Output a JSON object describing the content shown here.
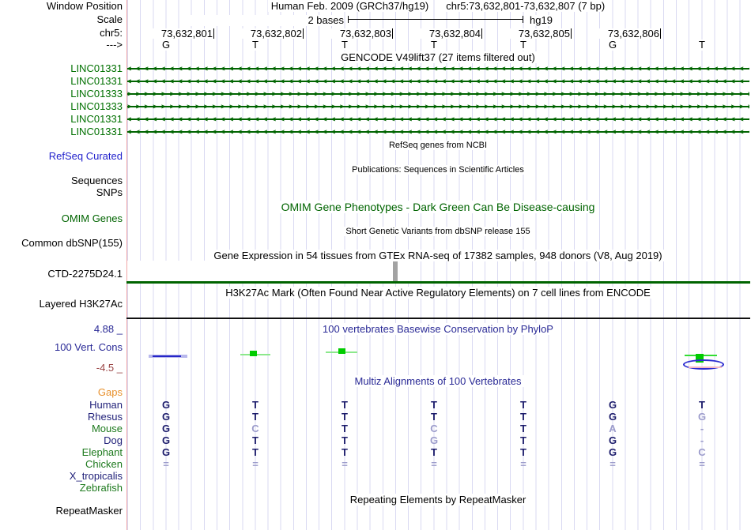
{
  "header": {
    "window_position_label": "Window Position",
    "assembly_title": "Human Feb. 2009 (GRCh37/hg19)",
    "range_title": "chr5:73,632,801-73,632,807 (7 bp)",
    "scale_label": "Scale",
    "scale_value": "2 bases",
    "scale_assembly": "hg19",
    "chrom_label": "chr5:",
    "strand_label": "--->",
    "coordinates": [
      "73,632,801",
      "73,632,802",
      "73,632,803",
      "73,632,804",
      "73,632,805",
      "73,632,806"
    ],
    "bases": [
      "G",
      "T",
      "T",
      "T",
      "T",
      "G",
      "T"
    ]
  },
  "gencode": {
    "title": "GENCODE V49lift37 (27 items filtered out)",
    "genes": [
      {
        "name": "LINC01331",
        "strand": "left"
      },
      {
        "name": "LINC01331",
        "strand": "left"
      },
      {
        "name": "LINC01333",
        "strand": "right"
      },
      {
        "name": "LINC01333",
        "strand": "right"
      },
      {
        "name": "LINC01331",
        "strand": "left"
      },
      {
        "name": "LINC01331",
        "strand": "left"
      }
    ]
  },
  "tracks": {
    "refseq": {
      "center_title": "RefSeq genes from NCBI",
      "label": "RefSeq Curated"
    },
    "publications": {
      "center_title": "Publications: Sequences in Scientific Articles",
      "label_sequences": "Sequences",
      "label_snps": "SNPs"
    },
    "omim": {
      "center_title": "OMIM Gene Phenotypes - Dark Green Can Be Disease-causing",
      "label": "OMIM Genes"
    },
    "dbsnp": {
      "center_title": "Short Genetic Variants from dbSNP release 155",
      "label": "Common dbSNP(155)"
    },
    "gtex": {
      "center_title": "Gene Expression in 54 tissues from GTEx RNA-seq of 17382 samples, 948 donors (V8, Aug 2019)",
      "label": "CTD-2275D24.1"
    },
    "h3k27ac": {
      "center_title": "H3K27Ac Mark (Often Found Near Active Regulatory Elements) on 7 cell lines from ENCODE",
      "label": "Layered H3K27Ac"
    },
    "conservation": {
      "center_title": "100 vertebrates Basewise Conservation by PhyloP",
      "label": "100 Vert. Cons",
      "max_value": "4.88 _",
      "min_value": "-4.5 _"
    },
    "multiz": {
      "center_title": "Multiz Alignments of 100 Vertebrates",
      "gaps_label": "Gaps",
      "rows": [
        {
          "species": "Human",
          "color": "navy",
          "cells": [
            "G",
            "T",
            "T",
            "T",
            "T",
            "G",
            "T"
          ],
          "muted": [
            0,
            0,
            0,
            0,
            0,
            0,
            0
          ]
        },
        {
          "species": "Rhesus",
          "color": "navy",
          "cells": [
            "G",
            "T",
            "T",
            "T",
            "T",
            "G",
            "G"
          ],
          "muted": [
            0,
            0,
            0,
            0,
            0,
            0,
            1
          ]
        },
        {
          "species": "Mouse",
          "color": "green",
          "cells": [
            "G",
            "C",
            "T",
            "C",
            "T",
            "A",
            "-"
          ],
          "muted": [
            0,
            1,
            0,
            1,
            0,
            1,
            1
          ]
        },
        {
          "species": "Dog",
          "color": "navy",
          "cells": [
            "G",
            "T",
            "T",
            "G",
            "T",
            "G",
            "-"
          ],
          "muted": [
            0,
            0,
            0,
            1,
            0,
            0,
            1
          ]
        },
        {
          "species": "Elephant",
          "color": "green",
          "cells": [
            "G",
            "T",
            "T",
            "T",
            "T",
            "G",
            "C"
          ],
          "muted": [
            0,
            0,
            0,
            0,
            0,
            0,
            1
          ]
        },
        {
          "species": "Chicken",
          "color": "green",
          "cells": [
            "=",
            "=",
            "=",
            "=",
            "=",
            "=",
            "="
          ],
          "muted": [
            1,
            1,
            1,
            1,
            1,
            1,
            1
          ]
        },
        {
          "species": "X_tropicalis",
          "color": "navy",
          "cells": [
            "",
            "",
            "",
            "",
            "",
            "",
            ""
          ],
          "muted": [
            0,
            0,
            0,
            0,
            0,
            0,
            0
          ]
        },
        {
          "species": "Zebrafish",
          "color": "green",
          "cells": [
            "",
            "",
            "",
            "",
            "",
            "",
            ""
          ],
          "muted": [
            0,
            0,
            0,
            0,
            0,
            0,
            0
          ]
        }
      ]
    },
    "repeatmasker": {
      "center_title": "Repeating Elements by RepeatMasker",
      "label": "RepeatMasker"
    }
  },
  "colors": {
    "track_green": "#006400",
    "gene_label_green": "#007000",
    "species_navy": "#22227a",
    "species_green": "#1e7a1e",
    "dark_letter": "#1b1b6b",
    "muted_letter": "#9c9ccb",
    "refseq_blue": "#2222cc",
    "gaps_orange": "#e8912d",
    "conservation_navy": "#2a2a96",
    "min_maroon": "#994444",
    "grid_line": "#d9d9f2",
    "edge_pink": "#f2a6a6",
    "gtex_bar_gray": "#a3a3a3"
  }
}
